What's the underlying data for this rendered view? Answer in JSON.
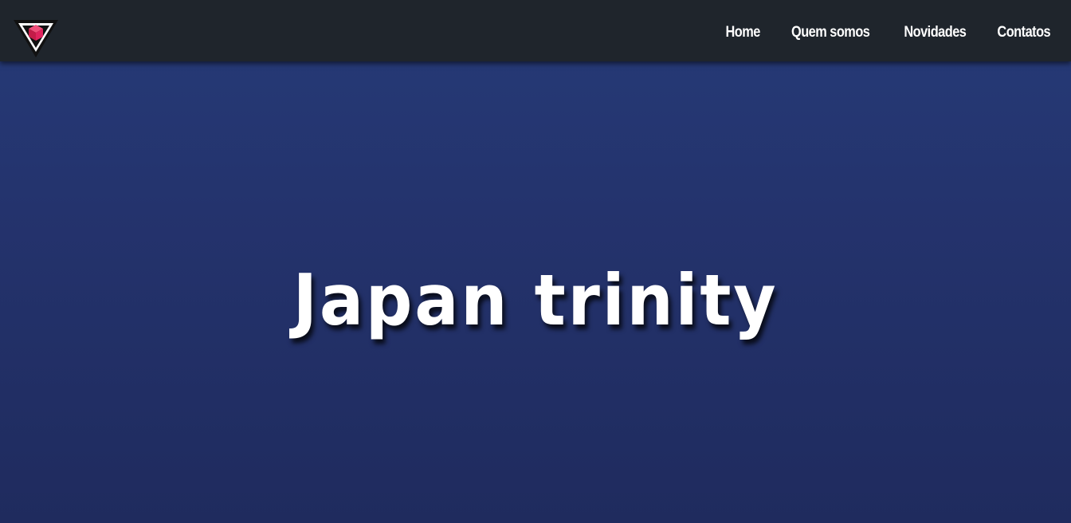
{
  "navbar": {
    "logo_icon": "red-cube-in-triangle-logo-icon",
    "links": [
      {
        "label": "Home"
      },
      {
        "label": "Quem somos"
      },
      {
        "label": "Novidades"
      },
      {
        "label": "Contatos"
      }
    ]
  },
  "hero": {
    "title": "Japan trinity"
  },
  "colors": {
    "navbar_background": "#1f252c",
    "hero_background_top": "#263b78",
    "hero_background_bottom": "#1f2b5e",
    "text": "#ffffff",
    "logo_accent": "#e0245e"
  }
}
